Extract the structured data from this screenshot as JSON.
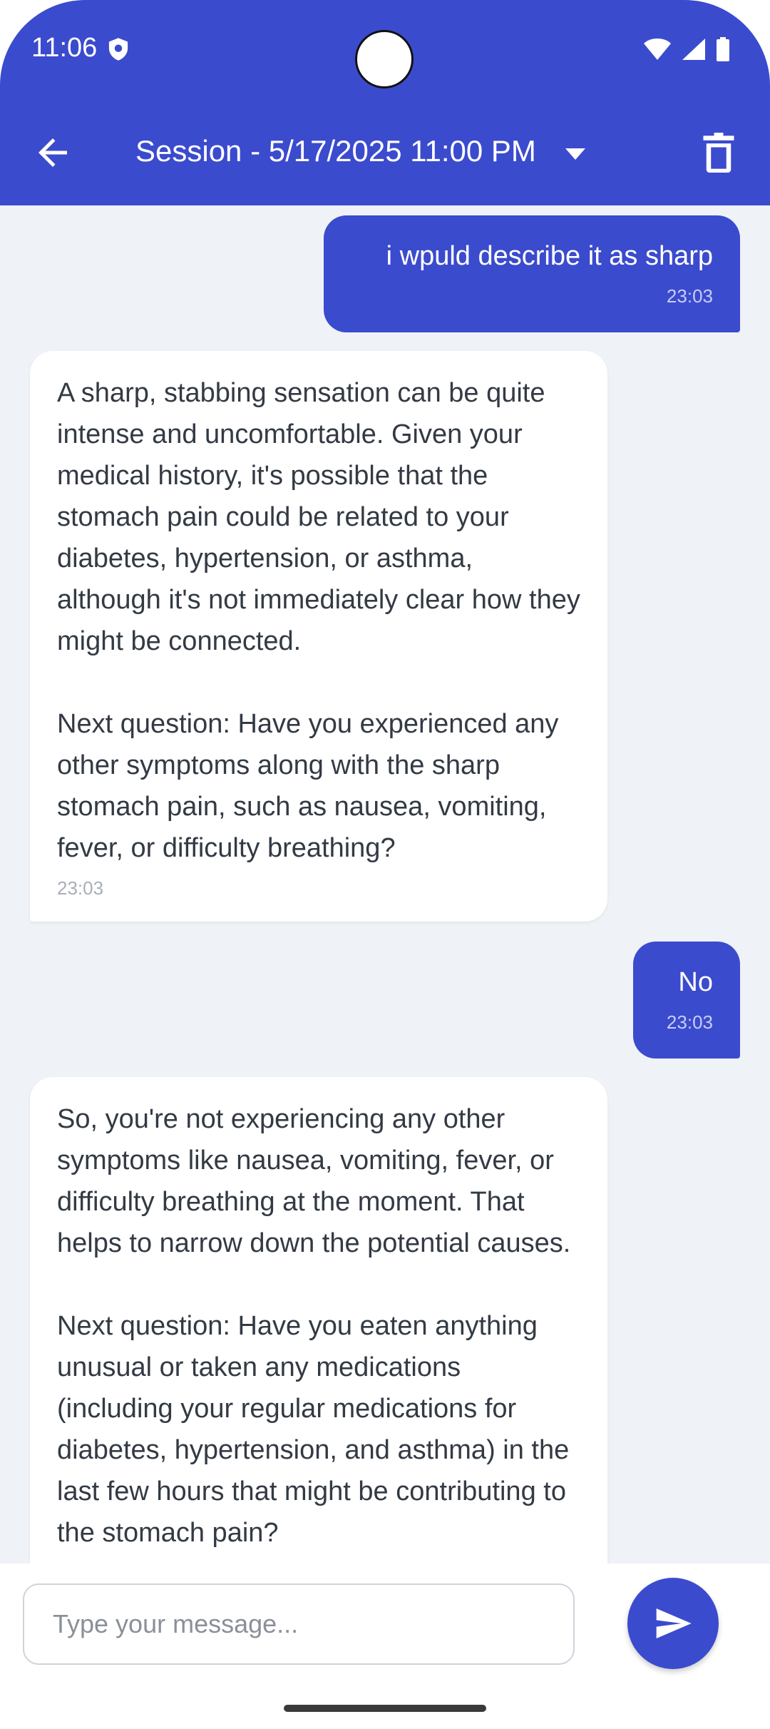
{
  "status_bar": {
    "time": "11:06"
  },
  "app_bar": {
    "title": "Session - 5/17/2025 11:00 PM",
    "back_icon": "arrow-left-icon",
    "dropdown_icon": "caret-down-icon",
    "delete_icon": "trash-icon"
  },
  "messages": [
    {
      "sender": "user",
      "text": "i wpuld describe it as sharp",
      "time": "23:03"
    },
    {
      "sender": "assistant",
      "text": "A sharp, stabbing sensation can be quite intense and uncomfortable. Given your medical history, it's possible that the stomach pain could be related to your diabetes, hypertension, or asthma, although it's not immediately clear how they might be connected.\n\nNext question: Have you experienced any other symptoms along with the sharp stomach pain, such as nausea, vomiting, fever, or difficulty breathing?",
      "time": "23:03"
    },
    {
      "sender": "user",
      "text": "No",
      "time": "23:03"
    },
    {
      "sender": "assistant",
      "text": "So, you're not experiencing any other symptoms like nausea, vomiting, fever, or difficulty breathing at the moment. That helps to narrow down the potential causes.\n\nNext question: Have you eaten anything unusual or taken any medications (including your regular medications for diabetes, hypertension, and asthma) in the last few hours that might be contributing to the stomach pain?",
      "time": ""
    }
  ],
  "composer": {
    "placeholder": "Type your message...",
    "send_icon": "send-icon"
  },
  "colors": {
    "primary": "#3b4bcd",
    "background": "#eff2f7",
    "bot_bubble": "#ffffff",
    "bot_text": "#333a44"
  }
}
